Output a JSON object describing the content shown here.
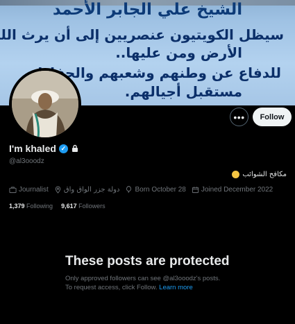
{
  "banner": {
    "title": "الشيخ علي الجابر الأحمد",
    "lines": [
      "سيظل الكويتيون عنصريين إلى أن يرث الله",
      "الأرض ومن عليها..",
      "للدفاع عن وطنهم وشعبهم والحفاظ",
      "مستقبل أجيالهم."
    ]
  },
  "actions": {
    "more_icon": "ellipsis-icon",
    "follow_label": "Follow"
  },
  "profile": {
    "display_name": "I'm khaled",
    "handle": "@al3ooodz",
    "bio": "مكافح الشوائب",
    "profession": "Journalist",
    "location": "دولة جزر الواق واق",
    "birthday": "Born October 28",
    "joined": "Joined December 2022"
  },
  "stats": {
    "following_count": "1,379",
    "following_label": "Following",
    "followers_count": "9,617",
    "followers_label": "Followers"
  },
  "protected": {
    "heading": "These posts are protected",
    "line1": "Only approved followers can see @al3ooodz's posts.",
    "line2_prefix": "To request access, click Follow. ",
    "learn_more": "Learn more"
  },
  "colors": {
    "background": "#000000",
    "accent": "#1d9bf0",
    "muted": "#71767b"
  }
}
